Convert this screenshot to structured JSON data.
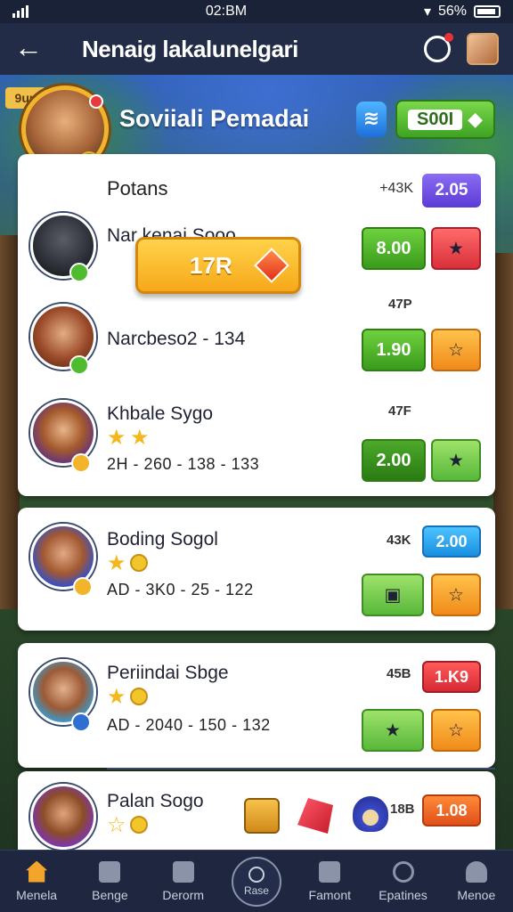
{
  "status_bar": {
    "time": "02:BM",
    "battery": "56%"
  },
  "header": {
    "title": "Nenaig lakalunelgari"
  },
  "hero": {
    "badge": "9uu",
    "title": "Soviiali Pemadai",
    "shield_icon": "shield-icon",
    "currency_value": "S00I"
  },
  "card_a": {
    "heading": "Potans",
    "heading_value": "+43K",
    "purple_button": "2.05",
    "popup_button": "17R",
    "rows": [
      {
        "name": "Nar kenai Sooo",
        "tag": "",
        "green_label": "8.00"
      },
      {
        "name": "Narcbeso2 - 134",
        "tag": "47P",
        "green_label": "1.90"
      },
      {
        "name": "Khbale Sygo",
        "tag": "47F",
        "sub": "2H - 260 - 138 - 133",
        "green_label": "2.00"
      }
    ]
  },
  "card_b": {
    "name": "Boding Sogol",
    "value": "43K",
    "sub": "AD - 3K0 - 25 - 122",
    "label_button": "2.00"
  },
  "card_c": {
    "name": "Periindai Sbge",
    "value": "45B",
    "sub": "AD - 2040 - 150 - 132",
    "label_button": "1.K9"
  },
  "card_d": {
    "name": "Palan Sogo",
    "value": "18B",
    "label_button": "1.08"
  },
  "bottom_nav": [
    {
      "label": "Menela",
      "icon": "home-icon"
    },
    {
      "label": "Benge",
      "icon": "clipboard-icon"
    },
    {
      "label": "Derorm",
      "icon": "shield-icon"
    },
    {
      "label": "Rase",
      "icon": "timer-icon"
    },
    {
      "label": "Famont",
      "icon": "gamepad-icon"
    },
    {
      "label": "Epatines",
      "icon": "target-icon"
    },
    {
      "label": "Menoe",
      "icon": "person-icon"
    }
  ],
  "colors": {
    "accent_green": "#4fbb2f",
    "accent_gold": "#f2b42a",
    "header_bg": "#232c47",
    "purple": "#5b3bd6"
  }
}
